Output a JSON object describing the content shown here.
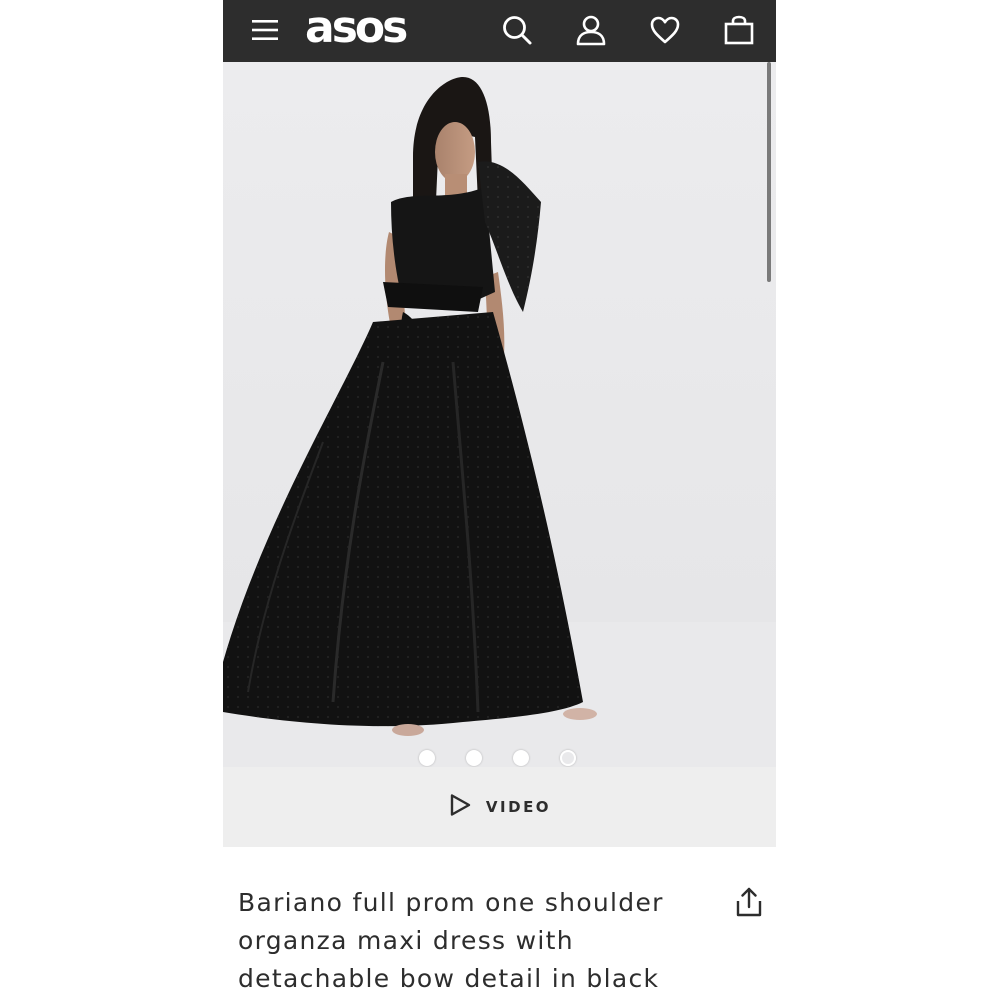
{
  "header": {
    "brand": "asos",
    "icons": [
      "menu-icon",
      "search-icon",
      "account-icon",
      "heart-icon",
      "bag-icon"
    ],
    "background": "#2d2d2d"
  },
  "gallery": {
    "image_count": 4,
    "active_index": 3
  },
  "video": {
    "label": "VIDEO"
  },
  "product": {
    "title": "Bariano full prom one shoulder organza maxi dress with detachable bow detail in black"
  }
}
